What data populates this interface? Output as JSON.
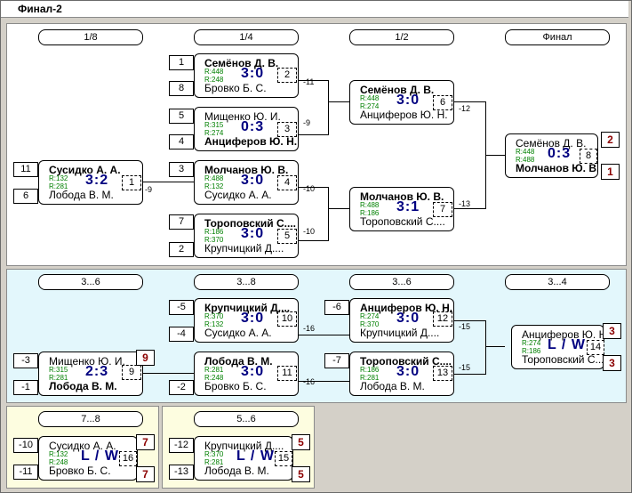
{
  "title": "Финал-2",
  "rounds_top": [
    "1/8",
    "1/4",
    "1/2",
    "Финал"
  ],
  "rounds_mid": [
    "3...6",
    "3...8",
    "3...6",
    "3...4"
  ],
  "round_78": "7...8",
  "round_56": "5...6",
  "seeds": {
    "s1": "1",
    "s8": "8",
    "s5": "5",
    "s4": "4",
    "s3": "3",
    "s7": "7",
    "s2": "2",
    "s11": "11",
    "s6": "6",
    "m5": "-5",
    "m4": "-4",
    "m3": "-3",
    "m1": "-1",
    "m2": "-2",
    "m6": "-6",
    "m7": "-7",
    "m10": "-10",
    "m11": "-11",
    "m12": "-12",
    "m13": "-13"
  },
  "matches": {
    "q1": {
      "p1": "Семёнов Д. В.",
      "r1": "R:448",
      "r2": "R:248",
      "p2": "Бровко Б. С.",
      "score": "3:0",
      "num": "2",
      "out": "-11"
    },
    "q2": {
      "p1": "Мищенко Ю. И.",
      "r1": "R:315",
      "r2": "R:274",
      "p2": "Анциферов Ю. Н.",
      "score": "0:3",
      "num": "3",
      "out": "-9"
    },
    "r16": {
      "p1": "Сусидко А. А.",
      "r1": "R:132",
      "r2": "R:281",
      "p2": "Лобода В. М.",
      "score": "3:2",
      "num": "1",
      "out": "-9"
    },
    "q3": {
      "p1": "Молчанов Ю. В.",
      "r1": "R:488",
      "r2": "R:132",
      "p2": "Сусидко А. А.",
      "score": "3:0",
      "num": "4",
      "out": "-10"
    },
    "q4": {
      "p1": "Тороповский С....",
      "r1": "R:186",
      "r2": "R:370",
      "p2": "Крупчицкий Д....",
      "score": "3:0",
      "num": "5",
      "out": "-10"
    },
    "s1": {
      "p1": "Семёнов Д. В.",
      "r1": "R:448",
      "r2": "R:274",
      "p2": "Анциферов Ю. Н.",
      "score": "3:0",
      "num": "6",
      "out": "-12"
    },
    "s2": {
      "p1": "Молчанов Ю. В.",
      "r1": "R:488",
      "r2": "R:186",
      "p2": "Тороповский С....",
      "score": "3:1",
      "num": "7",
      "out": "-13"
    },
    "f": {
      "p1": "Семёнов Д. В.",
      "r1": "R:448",
      "r2": "R:488",
      "p2": "Молчанов Ю. В.",
      "score": "0:3",
      "num": "8",
      "place1": "2",
      "place2": "1"
    },
    "c1": {
      "p1": "Крупчицкий Д....",
      "r1": "R:370",
      "r2": "R:132",
      "p2": "Сусидко А. А.",
      "score": "3:0",
      "num": "10",
      "out": "-16"
    },
    "c0": {
      "p1": "Мищенко Ю. И.",
      "r1": "R:315",
      "r2": "R:281",
      "p2": "Лобода В. М.",
      "score": "2:3",
      "num": "9",
      "place": "9"
    },
    "c2": {
      "p1": "Лобода В. М.",
      "r1": "R:281",
      "r2": "R:248",
      "p2": "Бровко Б. С.",
      "score": "3:0",
      "num": "11",
      "out": "-16"
    },
    "c3": {
      "p1": "Анциферов Ю. Н.",
      "r1": "R:274",
      "r2": "R:370",
      "p2": "Крупчицкий Д....",
      "score": "3:0",
      "num": "12",
      "out": "-15"
    },
    "c4": {
      "p1": "Тороповский С....",
      "r1": "R:186",
      "r2": "R:281",
      "p2": "Лобода В. М.",
      "score": "3:0",
      "num": "13",
      "out": "-15"
    },
    "c5": {
      "p1": "Анциферов Ю. Н.",
      "r1": "R:274",
      "r2": "R:186",
      "p2": "Тороповский С....",
      "score": "L / W",
      "num": "14",
      "place1": "3",
      "place2": "3"
    },
    "y1": {
      "p1": "Сусидко А. А.",
      "r1": "R:132",
      "r2": "R:248",
      "p2": "Бровко Б. С.",
      "score": "L / W",
      "num": "16",
      "place1": "7",
      "place2": "7"
    },
    "y2": {
      "p1": "Крупчицкий Д....",
      "r1": "R:370",
      "r2": "R:281",
      "p2": "Лобода В. М.",
      "score": "L / W",
      "num": "15",
      "place1": "5",
      "place2": "5"
    }
  }
}
